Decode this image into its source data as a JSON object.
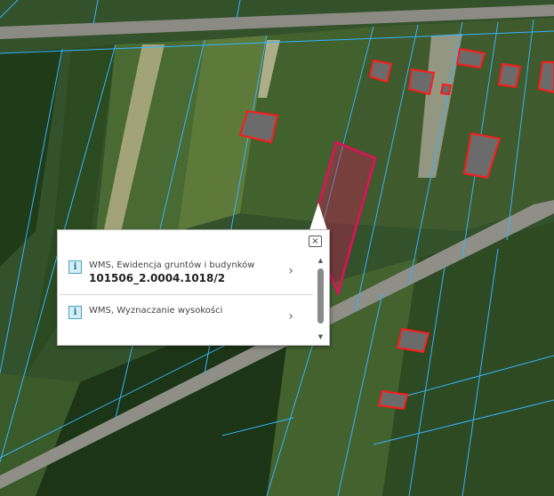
{
  "map": {
    "colors": {
      "field": "#3a5a27",
      "forest": "#1f3a17",
      "road": "#8a8a82",
      "parcel_line": "#33b4ff",
      "building_outline": "#ff1a1a",
      "selected_parcel": "#e0105a"
    }
  },
  "popup": {
    "close_symbol": "×",
    "results": [
      {
        "icon": "i",
        "title": "WMS, Ewidencja gruntów i budynków",
        "value": "101506_2.0004.1018/2",
        "chevron": "›"
      },
      {
        "icon": "i",
        "title": "WMS, Wyznaczanie wysokości",
        "value": "",
        "chevron": "›"
      }
    ],
    "scroll_up": "▲",
    "scroll_down": "▼"
  }
}
